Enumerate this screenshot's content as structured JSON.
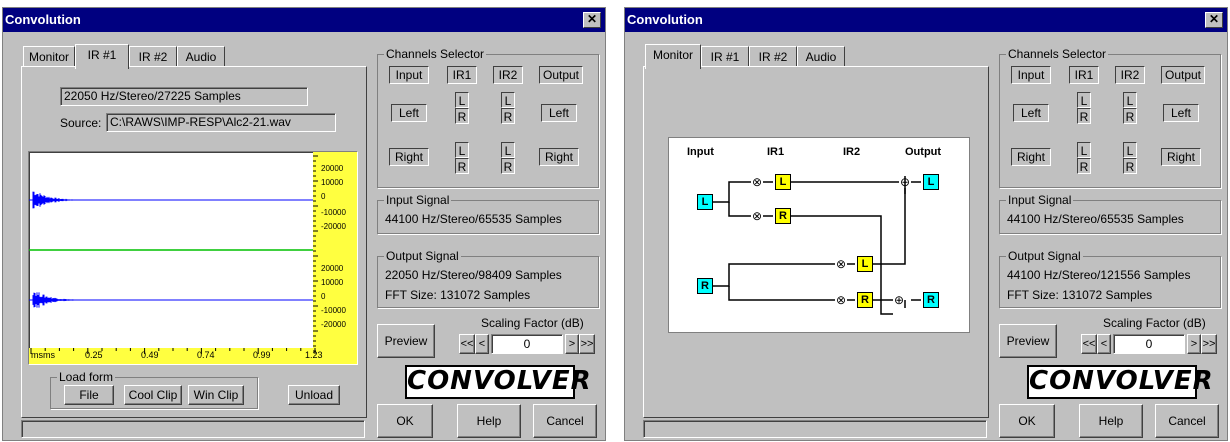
{
  "left": {
    "title": "Convolution",
    "close_glyph": "✕",
    "tabs": [
      "Monitor",
      "IR #1",
      "IR #2",
      "Audio"
    ],
    "active_tab": "IR #1",
    "file_format": "22050 Hz/Stereo/27225 Samples",
    "source_label": "Source:",
    "source_path": "C:\\RAWS\\IMP-RESP\\Alc2-21.wav",
    "waveform": {
      "y_ticks": [
        "20000",
        "10000",
        "0",
        "-10000",
        "-20000"
      ],
      "x_ticks": [
        "msms",
        "0.25",
        "0.49",
        "0.74",
        "0.99",
        "1.23"
      ],
      "wave_color": "#0000ff",
      "divider_color": "#00c000",
      "ruler_color": "#ffff40"
    },
    "load_form": {
      "label": "Load form",
      "file": "File",
      "cool_clip": "Cool Clip",
      "win_clip": "Win Clip"
    },
    "unload": "Unload"
  },
  "right": {
    "title": "Convolution",
    "close_glyph": "✕",
    "tabs": [
      "Monitor",
      "IR #1",
      "IR #2",
      "Audio"
    ],
    "active_tab": "Monitor",
    "diagram": {
      "headers": [
        "Input",
        "IR1",
        "IR2",
        "Output"
      ],
      "blocks": {
        "input_l": "L",
        "input_r": "R",
        "ir1_l": "L",
        "ir1_r": "R",
        "ir2_l": "L",
        "ir2_r": "R",
        "out_l": "L",
        "out_r": "R"
      },
      "multiply_glyph": "⊗",
      "sum_glyph": "⊕",
      "io_color": "#00ffff",
      "ir_color": "#ffff00"
    }
  },
  "panels": [
    {
      "channels": {
        "label": "Channels Selector",
        "input": "Input",
        "ir1": "IR1",
        "ir2": "IR2",
        "output": "Output",
        "left": "Left",
        "right": "Right",
        "l": "L",
        "r": "R"
      },
      "input_signal": {
        "label": "Input Signal",
        "value": "44100 Hz/Stereo/65535 Samples"
      },
      "output_signal": {
        "label": "Output Signal",
        "value": "22050 Hz/Stereo/98409 Samples",
        "fft": "FFT Size: 131072 Samples"
      },
      "preview": "Preview",
      "scaling": {
        "label": "Scaling Factor (dB)",
        "value": "0",
        "first": "<<",
        "prev": "<",
        "next": ">",
        "last": ">>"
      },
      "logo": "CONVOLVER",
      "ok": "OK",
      "help": "Help",
      "cancel": "Cancel"
    },
    {
      "channels": {
        "label": "Channels Selector",
        "input": "Input",
        "ir1": "IR1",
        "ir2": "IR2",
        "output": "Output",
        "left": "Left",
        "right": "Right",
        "l": "L",
        "r": "R"
      },
      "input_signal": {
        "label": "Input Signal",
        "value": "44100 Hz/Stereo/65535 Samples"
      },
      "output_signal": {
        "label": "Output Signal",
        "value": "44100 Hz/Stereo/121556 Samples",
        "fft": "FFT Size: 131072 Samples"
      },
      "preview": "Preview",
      "scaling": {
        "label": "Scaling Factor (dB)",
        "value": "0",
        "first": "<<",
        "prev": "<",
        "next": ">",
        "last": ">>"
      },
      "logo": "CONVOLVER",
      "ok": "OK",
      "help": "Help",
      "cancel": "Cancel"
    }
  ]
}
